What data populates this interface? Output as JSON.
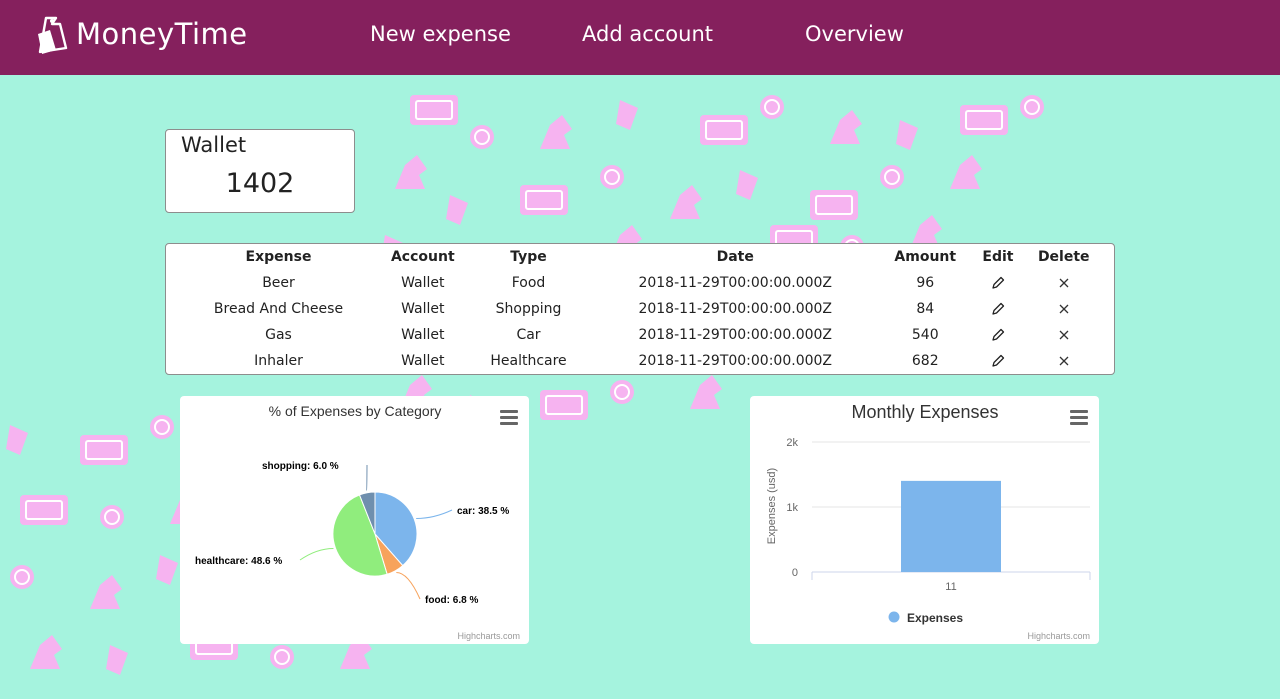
{
  "app": {
    "name": "MoneyTime",
    "logo_icon": "money-bag-icon"
  },
  "nav": [
    {
      "label": "New expense"
    },
    {
      "label": "Add account"
    },
    {
      "label": "Overview"
    }
  ],
  "wallet": {
    "name": "Wallet",
    "balance": "1402"
  },
  "table": {
    "headers": [
      "Expense",
      "Account",
      "Type",
      "Date",
      "Amount",
      "Edit",
      "Delete"
    ],
    "rows": [
      {
        "expense": "Beer",
        "account": "Wallet",
        "type": "Food",
        "date": "2018-11-29T00:00:00.000Z",
        "amount": "96"
      },
      {
        "expense": "Bread And Cheese",
        "account": "Wallet",
        "type": "Shopping",
        "date": "2018-11-29T00:00:00.000Z",
        "amount": "84"
      },
      {
        "expense": "Gas",
        "account": "Wallet",
        "type": "Car",
        "date": "2018-11-29T00:00:00.000Z",
        "amount": "540"
      },
      {
        "expense": "Inhaler",
        "account": "Wallet",
        "type": "Healthcare",
        "date": "2018-11-29T00:00:00.000Z",
        "amount": "682"
      }
    ],
    "edit_icon": "pencil-icon",
    "delete_icon": "close-icon"
  },
  "colors": {
    "background": "#a5f3de",
    "navbar": "#85205d",
    "pattern": "#f6b3f0"
  },
  "credits": "Highcharts.com",
  "chart_data": [
    {
      "type": "pie",
      "title": "% of Expenses by Category",
      "slices": [
        {
          "name": "car",
          "value": 38.5,
          "label": "car: 38.5 %",
          "color": "#7cb5ec"
        },
        {
          "name": "food",
          "value": 6.8,
          "label": "food: 6.8 %",
          "color": "#f7a35c"
        },
        {
          "name": "healthcare",
          "value": 48.6,
          "label": "healthcare: 48.6 %",
          "color": "#90ed7d"
        },
        {
          "name": "shopping",
          "value": 6.0,
          "label": "shopping: 6.0 %",
          "color": "#6f8fae"
        }
      ]
    },
    {
      "type": "bar",
      "title": "Monthly Expenses",
      "categories": [
        "11"
      ],
      "series": [
        {
          "name": "Expenses",
          "values": [
            1402
          ],
          "color": "#7cb5ec"
        }
      ],
      "ylabel": "Expenses (usd)",
      "yticks": [
        "0",
        "1k",
        "2k"
      ],
      "ylim": [
        0,
        2000
      ],
      "grid": true,
      "legend": "bottom"
    }
  ]
}
